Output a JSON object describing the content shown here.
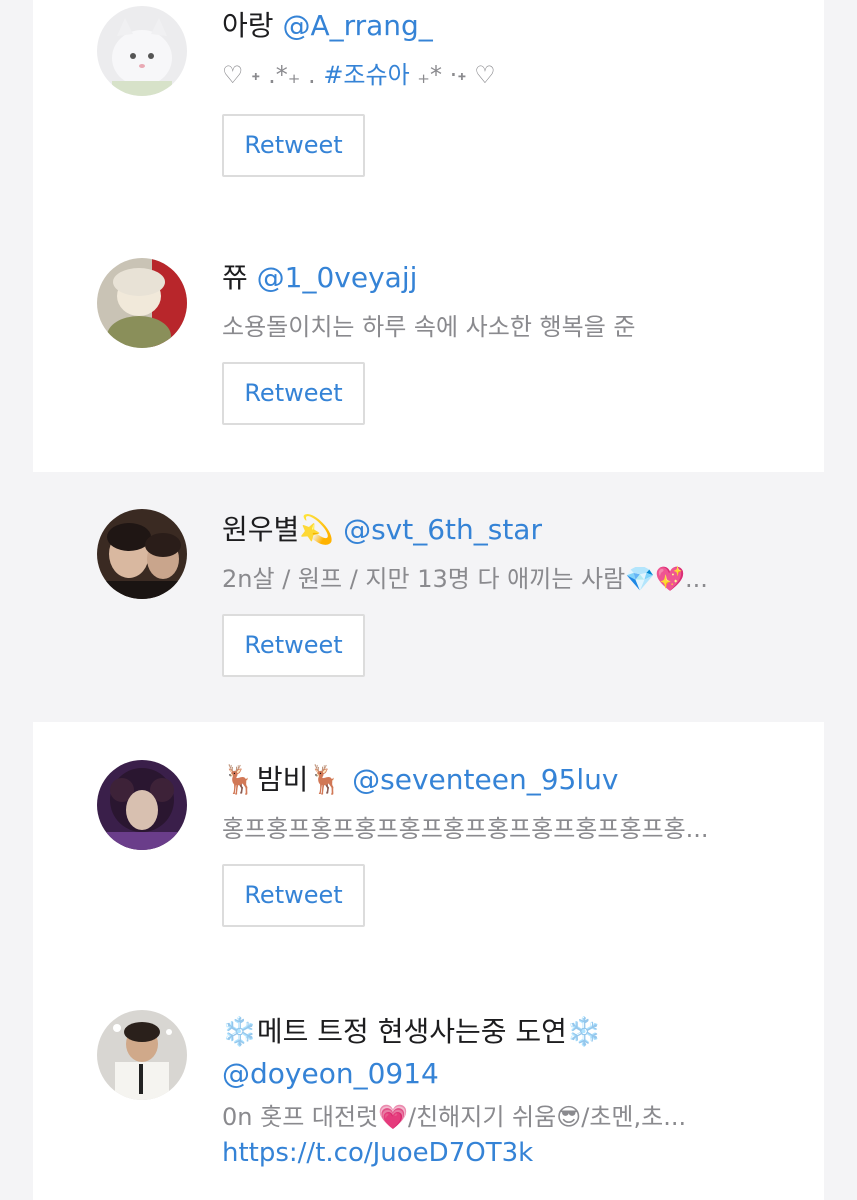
{
  "users": [
    {
      "name": "아랑",
      "handle": "@A_rrang_",
      "bio_prefix": "♡ ˖ .*₊ . ",
      "bio_tag": "#조슈아",
      "bio_suffix": " ₊* ·˖ ♡",
      "button_label": "Retweet"
    },
    {
      "name": "쮸",
      "handle": "@1_0veyajj",
      "bio": "소용돌이치는 하루 속에 사소한 행복을 준",
      "button_label": "Retweet"
    },
    {
      "name": "원우별💫",
      "handle": "@svt_6th_star",
      "bio": "2n살 / 원프 / 지만 13명 다 애끼는 사람💎💖...",
      "button_label": "Retweet"
    },
    {
      "name": "🦌밤비🦌",
      "handle": "@seventeen_95luv",
      "bio": "홍프홍프홍프홍프홍프홍프홍프홍프홍프홍프홍...",
      "button_label": "Retweet"
    },
    {
      "name": "❄️메트 트정 현생사는중 도연❄️",
      "handle": "@doyeon_0914",
      "bio": "0n 홋프 대전럿💗/친해지기 쉬움😎/초멘,초...",
      "link": "https://t.co/JuoeD7OT3k"
    }
  ],
  "colors": {
    "accent": "#3583d6",
    "background": "#f4f4f6",
    "card": "#ffffff",
    "muted_text": "#8a8a8e"
  }
}
